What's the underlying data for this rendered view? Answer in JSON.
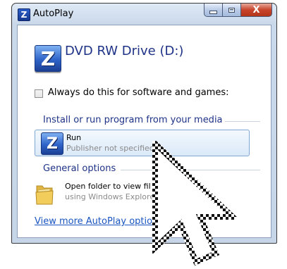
{
  "window": {
    "title": "AutoPlay",
    "app_icon_letter": "Z",
    "close_glyph": "X"
  },
  "drive": {
    "title": "DVD RW Drive (D:)",
    "icon_letter": "Z"
  },
  "always_checkbox": {
    "label": "Always do this for software and games:",
    "checked": false
  },
  "install_section": {
    "heading": "Install or run program from your media",
    "items": [
      {
        "label": "Run",
        "sublabel": "Publisher not specified",
        "icon_letter": "Z",
        "icon": "z-program-icon"
      }
    ]
  },
  "general_section": {
    "heading": "General options",
    "items": [
      {
        "label": "Open folder to view fil",
        "sublabel": "using Windows Explore",
        "icon": "folder-icon"
      }
    ]
  },
  "more_link": "View more AutoPlay option",
  "colors": {
    "heading_blue": "#1e3287",
    "link_blue": "#1a55c2",
    "close_red": "#c8452c"
  }
}
